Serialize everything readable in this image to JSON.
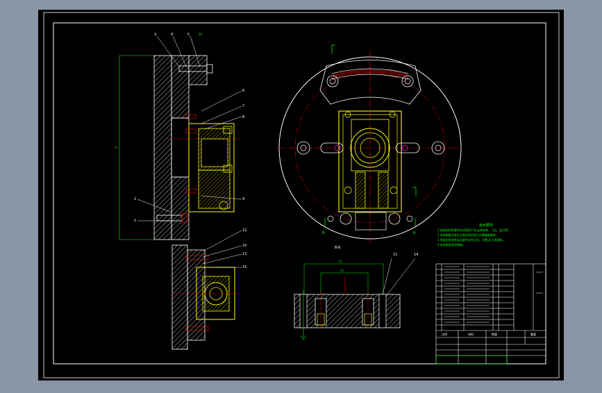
{
  "drawing": {
    "background": "#000000",
    "viewport_bg": "#8a95a5",
    "colors": {
      "outline": "#ffffff",
      "part": "#ffff00",
      "center": "#ff0000",
      "dimension": "#00ff00",
      "hatch": "#ffffff",
      "hidden": "#ff00ff",
      "bolt": "#ff0000"
    }
  },
  "section_views": {
    "bb_caption": "B-B",
    "marker_left": "B",
    "marker_right": "B"
  },
  "balloons": [
    "3",
    "4",
    "5",
    "16",
    "6",
    "7",
    "8",
    "9",
    "2",
    "1",
    "12",
    "10",
    "13",
    "15",
    "11",
    "14"
  ],
  "dimension_labels": {
    "side_height": "H",
    "bottom_outer": "L1",
    "bottom_inner": "L2"
  },
  "notes": {
    "title": "技术要求",
    "lines": [
      "1.装配前所有零件必须清洗干净,去除毛刺、飞边、油污等。",
      "2.夹具装配后各定位面应保证相互位置精度要求。",
      "3.装配后检查各运动部件动作灵活、可靠,无卡滞现象。",
      "4.夹具表面涂防锈漆。"
    ]
  },
  "title_block": {
    "scale": "比例",
    "material": "材料",
    "quantity": "数量",
    "weight": "重量"
  }
}
